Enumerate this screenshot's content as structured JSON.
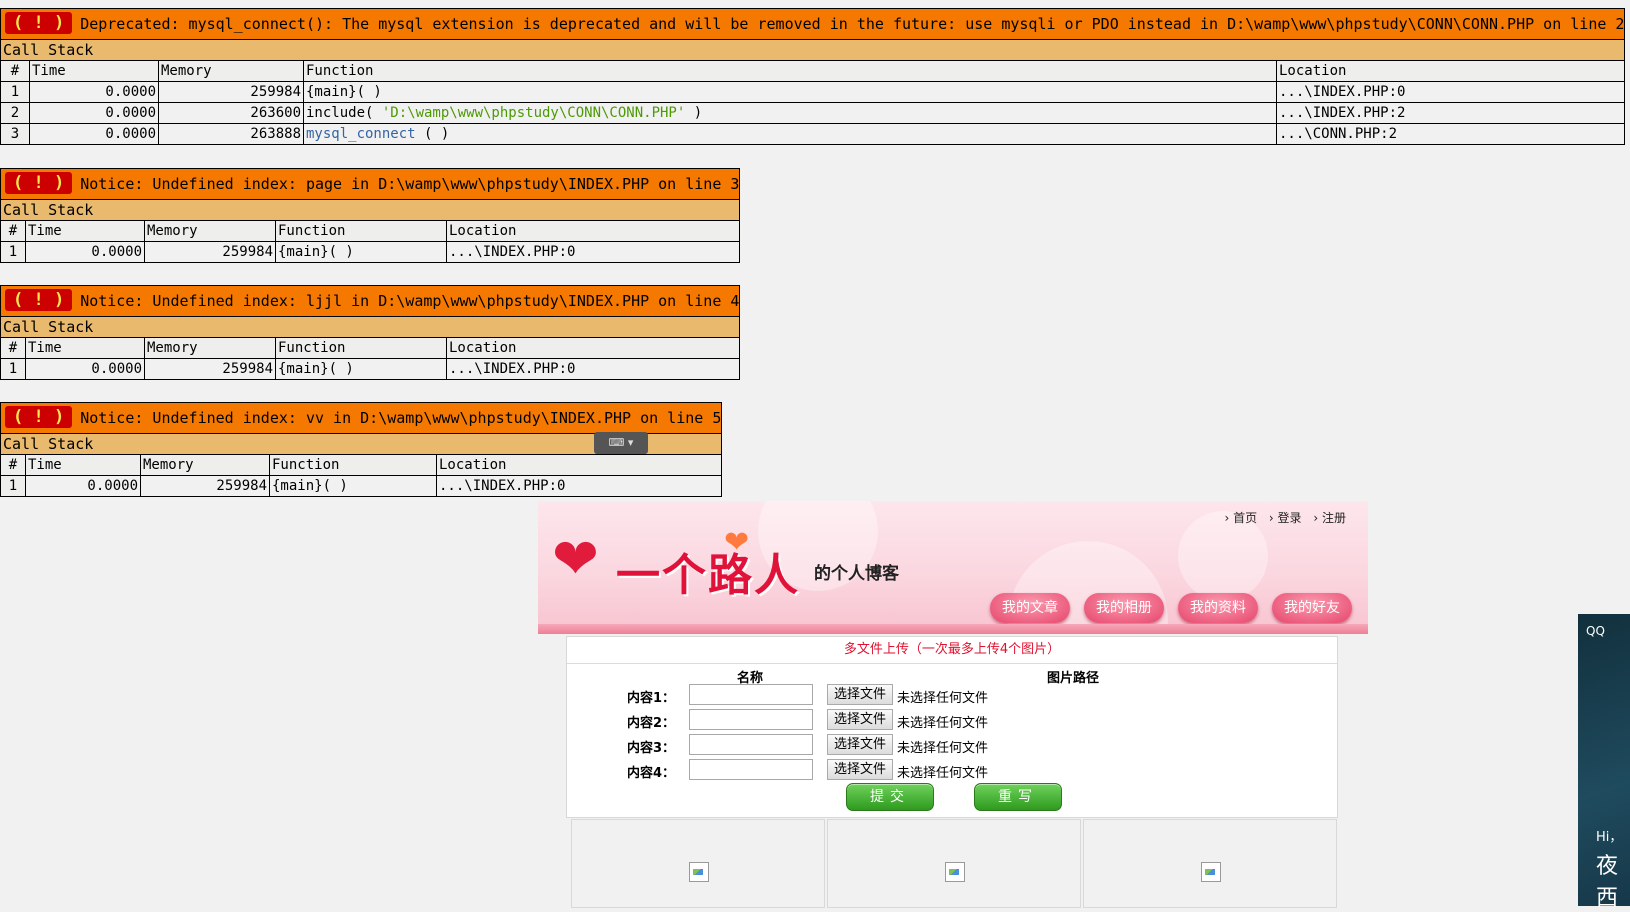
{
  "err1": {
    "label": "( ! )",
    "message": "Deprecated: mysql_connect(): The mysql extension is deprecated and will be removed in the future: use mysqli or PDO instead in D:\\wamp\\www\\phpstudy\\CONN\\CONN.PHP on line 2",
    "call_stack": "Call Stack",
    "headers": [
      "#",
      "Time",
      "Memory",
      "Function",
      "Location"
    ],
    "rows": [
      {
        "n": "1",
        "time": "0.0000",
        "mem": "259984",
        "fn": "{main}( )",
        "loc": "...\\INDEX.PHP:0"
      },
      {
        "n": "2",
        "time": "0.0000",
        "mem": "263600",
        "fn_pre": "include( ",
        "fn_arg": "'D:\\wamp\\www\\phpstudy\\CONN\\CONN.PHP'",
        "fn_post": " )",
        "loc": "...\\INDEX.PHP:2"
      },
      {
        "n": "3",
        "time": "0.0000",
        "mem": "263888",
        "fn_link": "mysql_connect",
        "fn_post": " ( )",
        "loc": "...\\CONN.PHP:2"
      }
    ]
  },
  "err2": {
    "label": "( ! )",
    "message": "Notice: Undefined index: page in D:\\wamp\\www\\phpstudy\\INDEX.PHP on line 3",
    "call_stack": "Call Stack",
    "headers": [
      "#",
      "Time",
      "Memory",
      "Function",
      "Location"
    ],
    "row": {
      "n": "1",
      "time": "0.0000",
      "mem": "259984",
      "fn": "{main}( )",
      "loc": "...\\INDEX.PHP:0"
    }
  },
  "err3": {
    "label": "( ! )",
    "message": "Notice: Undefined index: ljjl in D:\\wamp\\www\\phpstudy\\INDEX.PHP on line 4",
    "call_stack": "Call Stack",
    "headers": [
      "#",
      "Time",
      "Memory",
      "Function",
      "Location"
    ],
    "row": {
      "n": "1",
      "time": "0.0000",
      "mem": "259984",
      "fn": "{main}( )",
      "loc": "...\\INDEX.PHP:0"
    }
  },
  "err4": {
    "label": "( ! )",
    "message": "Notice: Undefined index: vv in D:\\wamp\\www\\phpstudy\\INDEX.PHP on line 5",
    "call_stack": "Call Stack",
    "headers": [
      "#",
      "Time",
      "Memory",
      "Function",
      "Location"
    ],
    "row": {
      "n": "1",
      "time": "0.0000",
      "mem": "259984",
      "fn": "{main}( )",
      "loc": "...\\INDEX.PHP:0"
    }
  },
  "keyboard_widget": "⌨ ▾",
  "banner": {
    "title": "一个路人",
    "subtitle": "的个人博客",
    "top_links": [
      "› 首页",
      "› 登录",
      "› 注册"
    ],
    "nav": [
      "我的文章",
      "我的相册",
      "我的资料",
      "我的好友"
    ]
  },
  "upload": {
    "title": "多文件上传（一次最多上传4个图片）",
    "col_name": "名称",
    "col_path": "图片路径",
    "rows": [
      {
        "label": "内容1：",
        "choose": "选择文件",
        "none": "未选择任何文件"
      },
      {
        "label": "内容2：",
        "choose": "选择文件",
        "none": "未选择任何文件"
      },
      {
        "label": "内容3：",
        "choose": "选择文件",
        "none": "未选择任何文件"
      },
      {
        "label": "内容4：",
        "choose": "选择文件",
        "none": "未选择任何文件"
      }
    ],
    "submit": "提交",
    "reset": "重写"
  },
  "qq_panel": {
    "title": "QQ",
    "hi": "Hi，",
    "big": "夜西"
  },
  "colors": {
    "error_header": "#f57900",
    "call_stack": "#e9b96e",
    "row_bg": "#eeeeec",
    "bang_bg": "#cc0000",
    "bang_fg": "#fce94f",
    "accent_red": "#e0122f",
    "button_green": "#2e9a1e"
  }
}
